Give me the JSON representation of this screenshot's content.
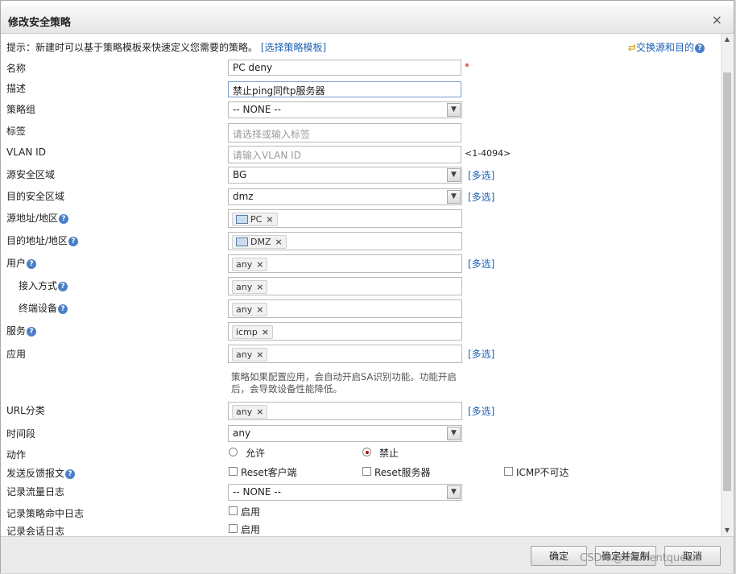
{
  "dialog": {
    "title": "修改安全策略",
    "close": "×"
  },
  "hint": {
    "text": "提示：新建时可以基于策略模板来快速定义您需要的策略。",
    "link": "[选择策略模板]",
    "swap": "交换源和目的"
  },
  "form": {
    "name": {
      "label": "名称",
      "value": "PC deny",
      "required": "*"
    },
    "desc": {
      "label": "描述",
      "value": "禁止ping同ftp服务器"
    },
    "group": {
      "label": "策略组",
      "value": "-- NONE --"
    },
    "tag": {
      "label": "标签",
      "placeholder": "请选择或输入标签"
    },
    "vlan": {
      "label": "VLAN ID",
      "placeholder": "请输入VLAN ID",
      "range": "<1-4094>"
    },
    "src_zone": {
      "label": "源安全区域",
      "value": "BG"
    },
    "dst_zone": {
      "label": "目的安全区域",
      "value": "dmz"
    },
    "src_addr": {
      "label": "源地址/地区",
      "tag": "PC"
    },
    "dst_addr": {
      "label": "目的地址/地区",
      "tag": "DMZ"
    },
    "user": {
      "label": "用户",
      "tag": "any"
    },
    "access": {
      "label": "接入方式",
      "tag": "any"
    },
    "terminal": {
      "label": "终端设备",
      "tag": "any"
    },
    "service": {
      "label": "服务",
      "tag": "icmp"
    },
    "app": {
      "label": "应用",
      "tag": "any",
      "note": "策略如果配置应用，会自动开启SA识别功能。功能开启后，会导致设备性能降低。"
    },
    "url": {
      "label": "URL分类",
      "tag": "any"
    },
    "time": {
      "label": "时间段",
      "value": "any"
    },
    "action": {
      "label": "动作",
      "allow": "允许",
      "deny": "禁止",
      "selected": "deny"
    },
    "feedback": {
      "label": "发送反馈报文",
      "opt1": "Reset客户端",
      "opt2": "Reset服务器",
      "opt3": "ICMP不可达"
    },
    "traffic_log": {
      "label": "记录流量日志",
      "value": "-- NONE --"
    },
    "hit_log": {
      "label": "记录策略命中日志",
      "opt": "启用"
    },
    "session_log": {
      "label": "记录会话日志",
      "opt": "启用"
    },
    "more": "[多选]",
    "remove": "×"
  },
  "footer": {
    "ok": "确定",
    "ok_copy": "确定并复制",
    "cancel": "取消"
  },
  "watermark": "CSDN @elementqueen"
}
